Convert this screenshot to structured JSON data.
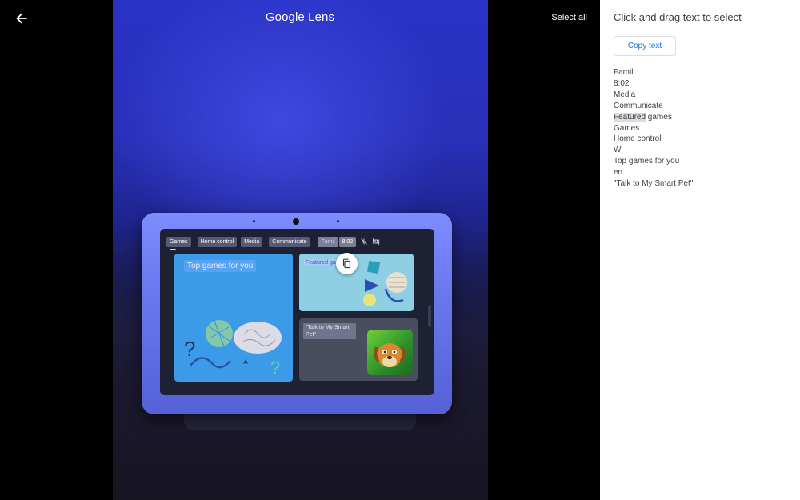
{
  "header": {
    "title": "Google Lens",
    "select_all": "Select all"
  },
  "device_screen": {
    "tabs": [
      "Games",
      "Home control",
      "Media",
      "Communicate"
    ],
    "status_partial": "Famil",
    "time": "8:02",
    "card_left_label": "Top games for you",
    "card_tr_label": "Featured ga",
    "card_br_label": "\"Talk to My Smart Pet\""
  },
  "panel": {
    "title": "Click and drag text to select",
    "copy_button": "Copy text",
    "lines": [
      {
        "text": "Famil"
      },
      {
        "text": "8:02"
      },
      {
        "text": "Media"
      },
      {
        "text": "Communicate"
      },
      {
        "highlight": "Featured",
        "rest": " games"
      },
      {
        "text": "Games"
      },
      {
        "text": "Home control"
      },
      {
        "text": "W"
      },
      {
        "text": "Top games for you"
      },
      {
        "text": "en"
      },
      {
        "text": "\"Talk to My Smart Pet\""
      }
    ]
  },
  "colors": {
    "panel_bg": "#ffffff",
    "accent": "#1a73e8",
    "highlight": "#dadce0"
  }
}
